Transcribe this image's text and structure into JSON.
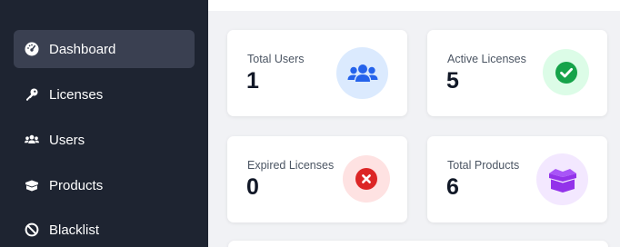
{
  "sidebar": {
    "items": [
      {
        "label": "Dashboard",
        "icon": "dashboard-gauge-icon",
        "active": true
      },
      {
        "label": "Licenses",
        "icon": "key-icon",
        "active": false
      },
      {
        "label": "Users",
        "icon": "users-icon",
        "active": false
      },
      {
        "label": "Products",
        "icon": "box-icon",
        "active": false
      },
      {
        "label": "Blacklist",
        "icon": "ban-icon",
        "active": false
      }
    ]
  },
  "stats": [
    {
      "label": "Total Users",
      "value": "1",
      "icon": "users-icon",
      "icon_color": "#2563eb",
      "icon_bg": "#dbeafe"
    },
    {
      "label": "Active Licenses",
      "value": "5",
      "icon": "check-circle-icon",
      "icon_color": "#16a34a",
      "icon_bg": "#dcfce7"
    },
    {
      "label": "Expired Licenses",
      "value": "0",
      "icon": "x-circle-icon",
      "icon_color": "#dc2626",
      "icon_bg": "#fee2e2"
    },
    {
      "label": "Total Products",
      "value": "6",
      "icon": "box-open-icon",
      "icon_color": "#9333ea",
      "icon_bg": "#f3e8ff"
    }
  ],
  "colors": {
    "sidebar_bg": "#1e2431",
    "sidebar_active": "#3a4051",
    "page_bg": "#f1f2f5"
  }
}
